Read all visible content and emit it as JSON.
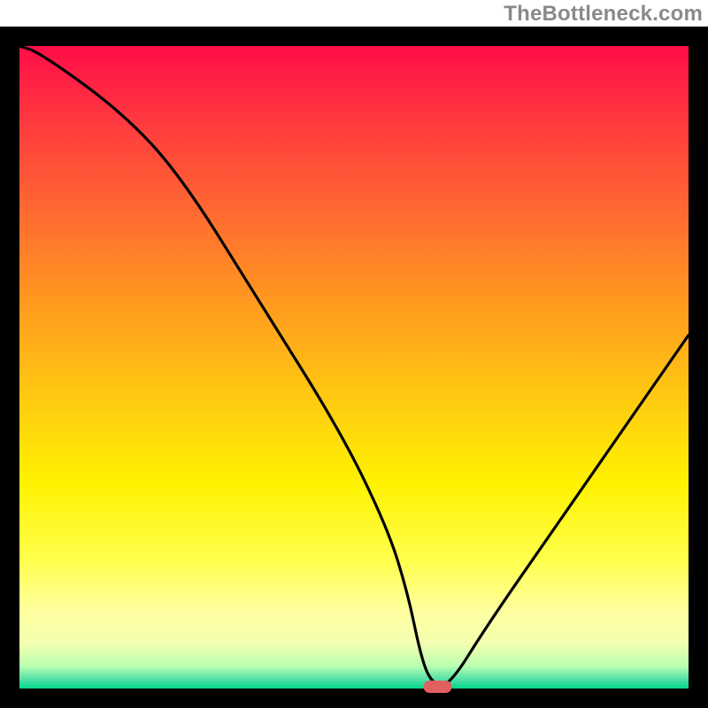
{
  "watermark": "TheBottleneck.com",
  "chart_data": {
    "type": "line",
    "title": "",
    "xlabel": "",
    "ylabel": "",
    "xlim": [
      0,
      100
    ],
    "ylim": [
      0,
      100
    ],
    "x": [
      0,
      3,
      15,
      24,
      36,
      48,
      55,
      58,
      60,
      61.5,
      64,
      70,
      80,
      90,
      100
    ],
    "values": [
      100,
      99,
      90,
      80,
      60,
      40,
      25,
      15,
      5,
      1,
      0,
      10,
      25,
      40,
      55
    ],
    "minimum_marker": {
      "x": 62.5,
      "y": 0
    },
    "background": "rainbow-vertical-gradient",
    "gradient_stops": [
      {
        "offset": 0.0,
        "color": "#ff0d48"
      },
      {
        "offset": 0.12,
        "color": "#ff3a3f"
      },
      {
        "offset": 0.26,
        "color": "#ff6a30"
      },
      {
        "offset": 0.4,
        "color": "#ff9a1f"
      },
      {
        "offset": 0.54,
        "color": "#ffc712"
      },
      {
        "offset": 0.68,
        "color": "#fff200"
      },
      {
        "offset": 0.8,
        "color": "#ffff4d"
      },
      {
        "offset": 0.88,
        "color": "#ffffa0"
      },
      {
        "offset": 0.93,
        "color": "#f2ffb0"
      },
      {
        "offset": 0.965,
        "color": "#baffb0"
      },
      {
        "offset": 0.985,
        "color": "#55e0a7"
      },
      {
        "offset": 1.0,
        "color": "#00d98b"
      }
    ],
    "frame_color": "#000000",
    "line_color": "#000000",
    "marker_color": "#e06060"
  }
}
